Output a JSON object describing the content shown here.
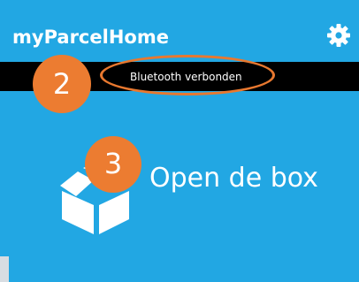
{
  "app_bar": {
    "title": "myParcelHome",
    "settings_icon": "gear-icon",
    "background": "#22a7e3"
  },
  "status_strip": {
    "text": "Bluetooth verbonden",
    "background": "#000000"
  },
  "main": {
    "background": "#22a7e3",
    "open_box": {
      "label": "Open de box",
      "icon": "box-icon"
    }
  },
  "annotations": {
    "color": "#ec7c31",
    "badges": [
      "2",
      "3"
    ]
  }
}
